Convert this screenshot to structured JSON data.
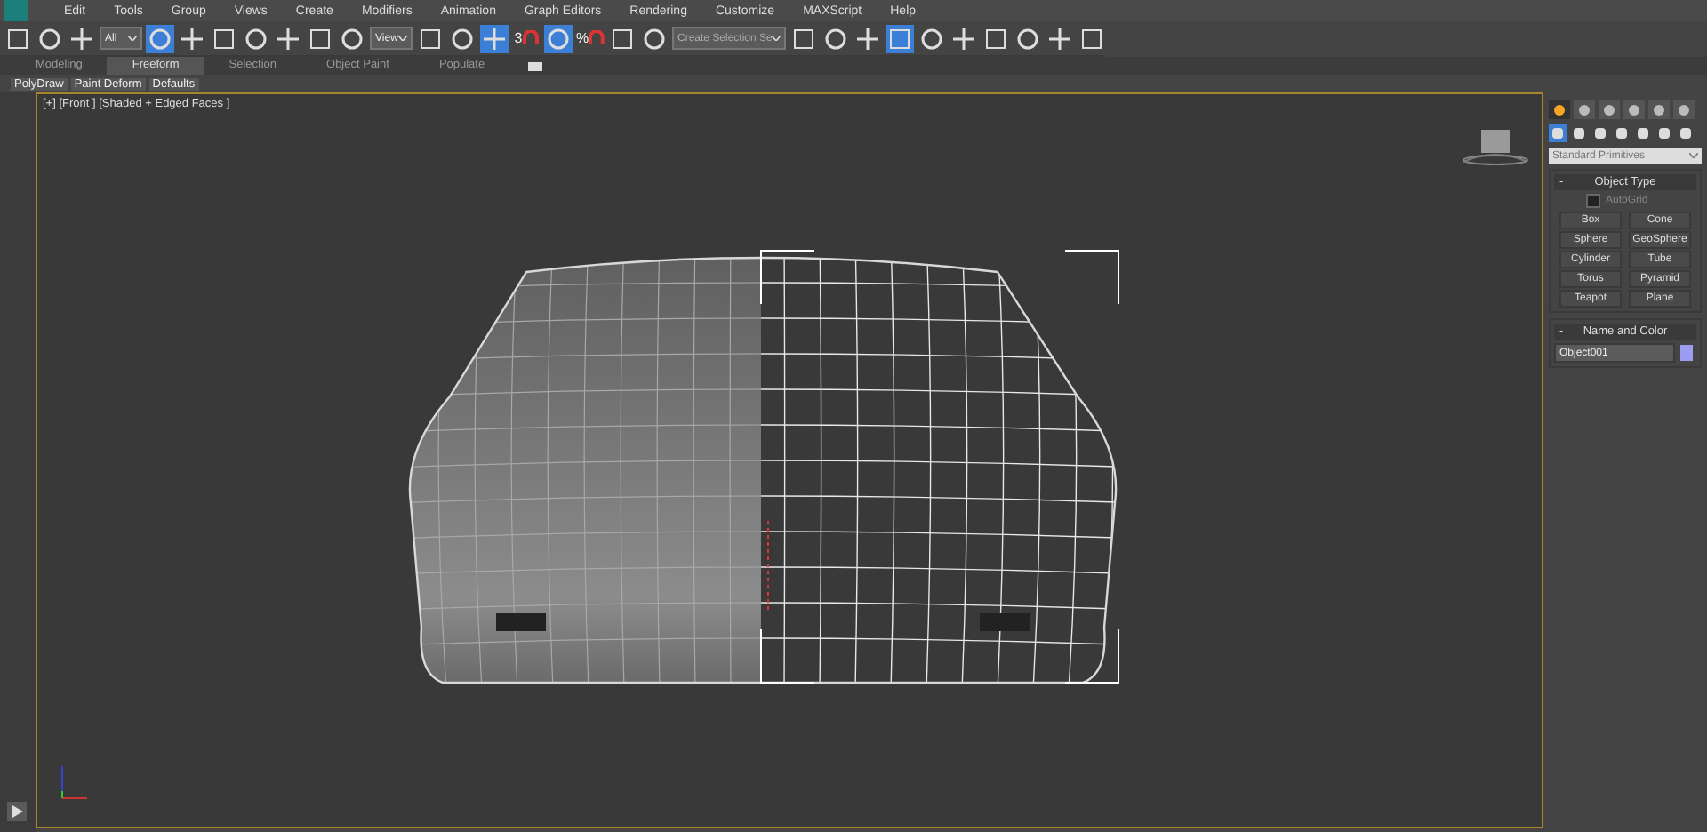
{
  "menu": [
    "Edit",
    "Tools",
    "Group",
    "Views",
    "Create",
    "Modifiers",
    "Animation",
    "Graph Editors",
    "Rendering",
    "Customize",
    "MAXScript",
    "Help"
  ],
  "toolbar": [
    {
      "kind": "button",
      "selected": false
    },
    {
      "kind": "button",
      "selected": false
    },
    {
      "kind": "button",
      "selected": false
    },
    {
      "kind": "dropdown",
      "value": "All"
    },
    {
      "kind": "button",
      "selected": true
    },
    {
      "kind": "button",
      "selected": false
    },
    {
      "kind": "button",
      "selected": false
    },
    {
      "kind": "button",
      "selected": false
    },
    {
      "kind": "button",
      "selected": false
    },
    {
      "kind": "button",
      "selected": false
    },
    {
      "kind": "button",
      "selected": false
    },
    {
      "kind": "dropdown",
      "value": "View"
    },
    {
      "kind": "button",
      "selected": false
    },
    {
      "kind": "button",
      "selected": false
    },
    {
      "kind": "button",
      "selected": true
    },
    {
      "kind": "snap",
      "label": "3",
      "selected": false
    },
    {
      "kind": "button",
      "selected": true
    },
    {
      "kind": "snap",
      "label": "%",
      "selected": false
    },
    {
      "kind": "button",
      "selected": false
    },
    {
      "kind": "button",
      "selected": false
    },
    {
      "kind": "dropdown",
      "value": "Create Selection Se"
    },
    {
      "kind": "button",
      "selected": false
    },
    {
      "kind": "button",
      "selected": false
    },
    {
      "kind": "button",
      "selected": false
    },
    {
      "kind": "button",
      "selected": true
    },
    {
      "kind": "button",
      "selected": false
    },
    {
      "kind": "button",
      "selected": false
    },
    {
      "kind": "button",
      "selected": false
    },
    {
      "kind": "button",
      "selected": false
    },
    {
      "kind": "button",
      "selected": false
    },
    {
      "kind": "button",
      "selected": false
    }
  ],
  "ribbon_tabs": [
    {
      "label": "Modeling",
      "selected": false
    },
    {
      "label": "Freeform",
      "selected": true
    },
    {
      "label": "Selection",
      "selected": false
    },
    {
      "label": "Object Paint",
      "selected": false
    },
    {
      "label": "Populate",
      "selected": false
    }
  ],
  "ribbon_panels": [
    "PolyDraw",
    "Paint Deform",
    "Defaults"
  ],
  "viewport": {
    "label": "[+] [Front ] [Shaded + Edged Faces ]"
  },
  "command_tabs": [
    {
      "selected": true
    },
    {
      "selected": false
    },
    {
      "selected": false
    },
    {
      "selected": false
    },
    {
      "selected": false
    },
    {
      "selected": false
    }
  ],
  "create_categories": [
    {
      "selected": true
    },
    {
      "selected": false
    },
    {
      "selected": false
    },
    {
      "selected": false
    },
    {
      "selected": false
    },
    {
      "selected": false
    },
    {
      "selected": false
    }
  ],
  "category_dropdown": "Standard Primitives",
  "object_type": {
    "title": "Object Type",
    "collapse": "-",
    "autogrid": {
      "label": "AutoGrid",
      "checked": false
    },
    "buttons": [
      "Box",
      "Cone",
      "Sphere",
      "GeoSphere",
      "Cylinder",
      "Tube",
      "Torus",
      "Pyramid",
      "Teapot",
      "Plane"
    ]
  },
  "name_and_color": {
    "title": "Name and Color",
    "collapse": "-",
    "name": "Object001",
    "color": "#9c9cf2"
  }
}
